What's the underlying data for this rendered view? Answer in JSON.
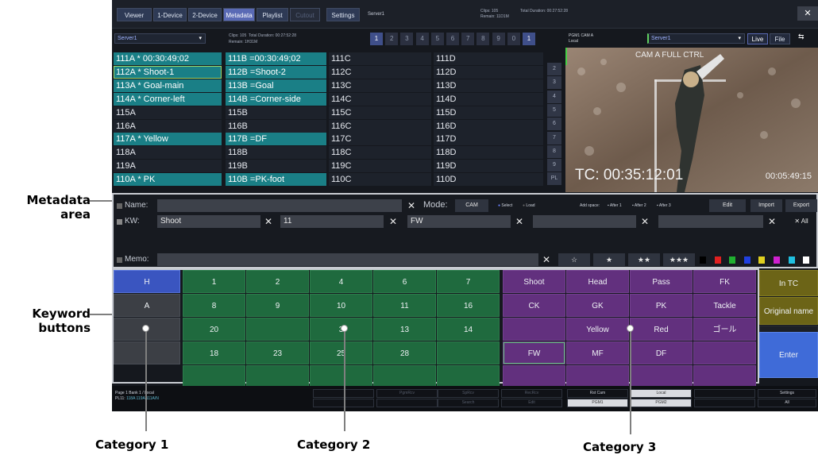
{
  "top_menu": {
    "tabs": [
      {
        "label": "Viewer"
      },
      {
        "label": "1-Device"
      },
      {
        "label": "2-Device"
      },
      {
        "label": "Metadata"
      },
      {
        "label": "Playlist"
      },
      {
        "label": "Cutout"
      },
      {
        "label": "Settings"
      }
    ],
    "server_name": "Server1",
    "clips_info": "Clips: 105",
    "total_duration": "Total Duration: 00:27:52:28",
    "remain": "Remain: 11D1M",
    "close_label": "✕"
  },
  "clip_list": {
    "server_select": "Server1",
    "clips_info": "Clips: 105",
    "total_duration": "Total Duration: 00:27:52:28",
    "remain": "Remain: 1H31M",
    "banks": [
      "1",
      "2",
      "3",
      "4",
      "5",
      "6",
      "7",
      "8",
      "9",
      "0",
      "1"
    ],
    "side_buttons": [
      "2",
      "3",
      "4",
      "5",
      "6",
      "7",
      "8",
      "9",
      "PL"
    ],
    "columns": [
      [
        "111A  * 00:30:49;02",
        "112A  * Shoot-1",
        "113A  * Goal-main",
        "114A  * Corner-left",
        "115A",
        "116A",
        "117A  * Yellow",
        "118A",
        "119A",
        "110A  * PK"
      ],
      [
        "111B  =00:30:49;02",
        "112B  =Shoot-2",
        "113B  =Goal",
        "114B  =Corner-side",
        "115B",
        "116B",
        "117B  =DF",
        "118B",
        "119B",
        "110B  =PK-foot"
      ],
      [
        "111C",
        "112C",
        "113C",
        "114C",
        "115C",
        "116C",
        "117C",
        "118C",
        "119C",
        "110C"
      ],
      [
        "111D",
        "112D",
        "113D",
        "114D",
        "115D",
        "116D",
        "117D",
        "118D",
        "119D",
        "110D"
      ]
    ]
  },
  "player": {
    "pgm_label": "PGM1  CAM A",
    "local_label": "Local",
    "server_select": "Server1",
    "live_label": "Live",
    "file_label": "File",
    "cam_caption": "CAM A  FULL CTRL",
    "timecode": "TC: 00:35:12:01",
    "timecode_small": "00:05:49:15"
  },
  "metadata": {
    "name_label": "Name:",
    "mode_label": "Mode:",
    "mode_value": "CAM",
    "select_label": "Select",
    "load_label": "Load",
    "add_space_label": "Add space:",
    "after1": "After 1",
    "after2": "After 2",
    "after3": "After 3",
    "edit_label": "Edit",
    "import_label": "Import",
    "export_label": "Export",
    "kw_label": "KW:",
    "kw_values": [
      "Shoot",
      "11",
      "FW",
      "",
      ""
    ],
    "x_all_label": "✕ All",
    "memo_label": "Memo:",
    "stars": [
      "☆",
      "★",
      "★★",
      "★★★"
    ],
    "swatch_colors": [
      "#000000",
      "#e02020",
      "#20b030",
      "#2040e0",
      "#e0d020",
      "#d020d0",
      "#20c0e0",
      "#ffffff"
    ]
  },
  "keywords": {
    "category1": [
      "H",
      "A",
      "",
      ""
    ],
    "category2": [
      [
        "1",
        "2",
        "4",
        "6",
        "7"
      ],
      [
        "8",
        "9",
        "10",
        "11",
        "16"
      ],
      [
        "20",
        "",
        "3",
        "13",
        "14"
      ],
      [
        "18",
        "23",
        "25",
        "28",
        ""
      ],
      [
        "",
        "",
        "",
        "",
        ""
      ]
    ],
    "category3": [
      [
        "Shoot",
        "Head",
        "Pass",
        "FK"
      ],
      [
        "CK",
        "GK",
        "PK",
        "Tackle"
      ],
      [
        "",
        "Yellow",
        "Red",
        "ゴール"
      ],
      [
        "FW",
        "MF",
        "DF",
        ""
      ],
      [
        "",
        "",
        "",
        ""
      ]
    ],
    "right": {
      "in_tc": "In TC",
      "original_name": "Original name",
      "enter": "Enter"
    }
  },
  "bottom": {
    "page_info": "Page 1 Bank 1 / Local",
    "pl_label": "PL11:",
    "pl_value": "118A 119A 111A/N",
    "cells_row1": [
      "",
      "PgmRcv",
      "SpRcv",
      "RecRcv",
      "Rst Cam",
      "Local",
      "",
      "Settings"
    ],
    "cells_row2": [
      "",
      "",
      "Search",
      "Edit",
      "PGM1",
      "PGM2",
      "",
      "All"
    ]
  },
  "annotations": {
    "metadata_area": "Metadata\narea",
    "keyword_buttons": "Keyword\nbuttons",
    "category1": "Category 1",
    "category2": "Category 2",
    "category3": "Category 3"
  }
}
